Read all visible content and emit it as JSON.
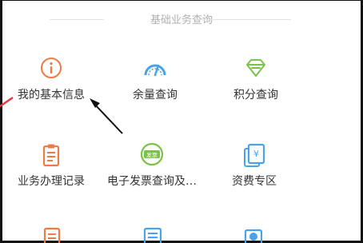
{
  "section": {
    "title": "基础业务查询"
  },
  "items": [
    {
      "label": "我的基本信息",
      "icon": "info-circle-icon",
      "color": "#f07a45"
    },
    {
      "label": "余量查询",
      "icon": "gauge-icon",
      "color": "#4aa3ea"
    },
    {
      "label": "积分查询",
      "icon": "diamond-icon",
      "color": "#7ac24a"
    },
    {
      "label": "业务办理记录",
      "icon": "clipboard-icon",
      "color": "#f07a45"
    },
    {
      "label": "电子发票查询及…",
      "icon": "invoice-icon",
      "color": "#7ac24a",
      "badge": "发票"
    },
    {
      "label": "资费专区",
      "icon": "tariff-icon",
      "color": "#4aa3ea",
      "badge": "¥"
    }
  ],
  "colors": {
    "annotation_red": "#e23b3b",
    "arrow": "#111111"
  }
}
